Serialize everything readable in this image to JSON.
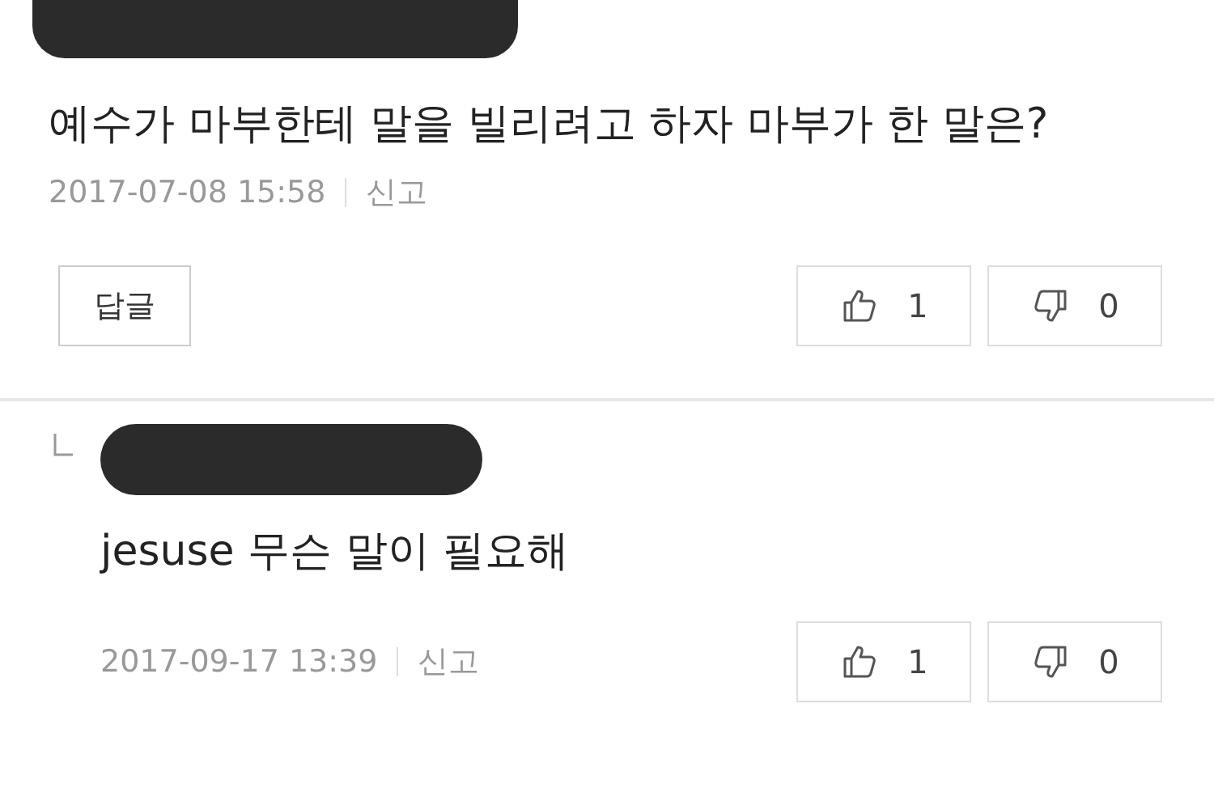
{
  "comments": [
    {
      "text": "예수가 마부한테 말을 빌리려고 하자 마부가 한 말은?",
      "date": "2017-07-08 15:58",
      "report": "신고",
      "reply_button": "답글",
      "likes": "1",
      "dislikes": "0",
      "children": [
        {
          "text": "jesuse 무슨 말이 필요해",
          "date": "2017-09-17 13:39",
          "report": "신고",
          "likes": "1",
          "dislikes": "0"
        }
      ]
    }
  ]
}
